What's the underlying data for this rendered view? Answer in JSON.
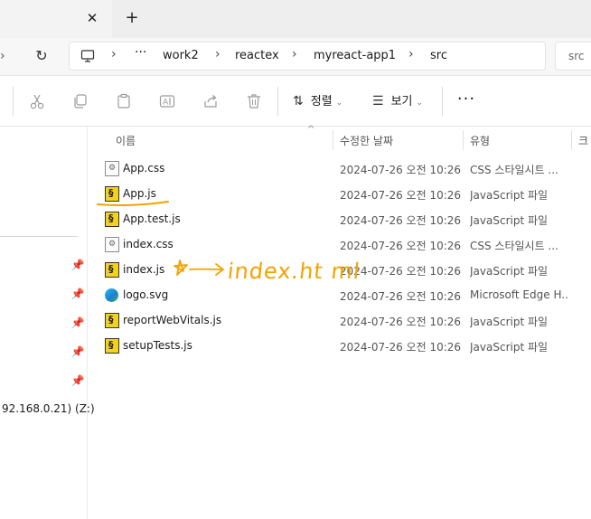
{
  "titlebar": {
    "close_glyph": "✕",
    "new_tab_glyph": "+"
  },
  "navigation": {
    "back_glyph": "›",
    "refresh_glyph": "↻"
  },
  "breadcrumb": {
    "items": [
      "work2",
      "reactex",
      "myreact-app1",
      "src"
    ],
    "overflow": "···",
    "separator": "›"
  },
  "search": {
    "placeholder": "src"
  },
  "toolbar": {
    "sort_label": "정렬",
    "view_label": "보기",
    "more_glyph": "···"
  },
  "columns": {
    "name": "이름",
    "date": "수정한 날짜",
    "type": "유형",
    "size": "크"
  },
  "sidebar": {
    "drive_label": "92.168.0.21) (Z:)",
    "pin_count": 5
  },
  "files": [
    {
      "name": "App.css",
      "date": "2024-07-26 오전 10:26",
      "type": "CSS 스타일시트 ...",
      "icon": "css-file-icon"
    },
    {
      "name": "App.js",
      "date": "2024-07-26 오전 10:26",
      "type": "JavaScript 파일",
      "icon": "js-file-icon"
    },
    {
      "name": "App.test.js",
      "date": "2024-07-26 오전 10:26",
      "type": "JavaScript 파일",
      "icon": "js-file-icon"
    },
    {
      "name": "index.css",
      "date": "2024-07-26 오전 10:26",
      "type": "CSS 스타일시트 ...",
      "icon": "css-file-icon"
    },
    {
      "name": "index.js",
      "date": "2024-07-26 오전 10:26",
      "type": "JavaScript 파일",
      "icon": "js-file-icon"
    },
    {
      "name": "logo.svg",
      "date": "2024-07-26 오전 10:26",
      "type": "Microsoft Edge H...",
      "icon": "edge-icon"
    },
    {
      "name": "reportWebVitals.js",
      "date": "2024-07-26 오전 10:26",
      "type": "JavaScript 파일",
      "icon": "js-file-icon"
    },
    {
      "name": "setupTests.js",
      "date": "2024-07-26 오전 10:26",
      "type": "JavaScript 파일",
      "icon": "js-file-icon"
    }
  ],
  "annotation": {
    "text": "index.ht ml",
    "color": "#f2a300"
  }
}
